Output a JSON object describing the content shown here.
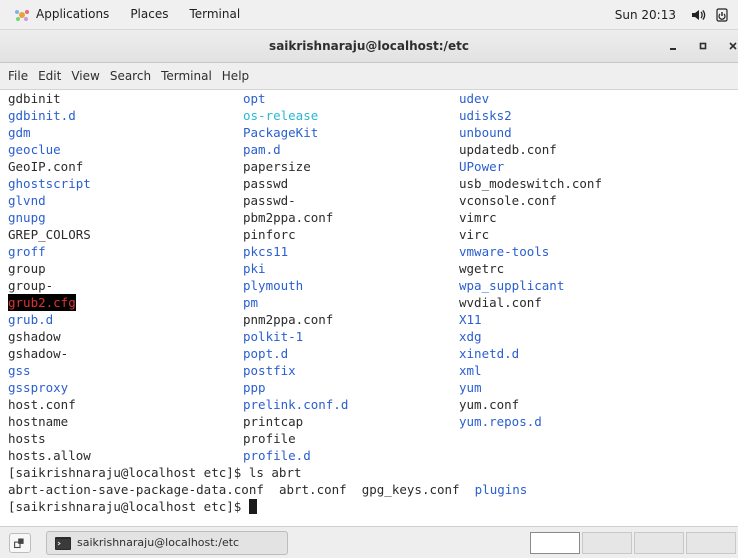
{
  "top_panel": {
    "applications": "Applications",
    "places": "Places",
    "terminal": "Terminal",
    "clock": "Sun 20:13",
    "icons": [
      "applications-icon",
      "volume-icon",
      "power-icon"
    ]
  },
  "window": {
    "title": "saikrishnaraju@localhost:/etc"
  },
  "menu": [
    "File",
    "Edit",
    "View",
    "Search",
    "Terminal",
    "Help"
  ],
  "listing": {
    "col1": [
      {
        "t": "gdbinit",
        "c": "file"
      },
      {
        "t": "gdbinit.d",
        "c": "dir"
      },
      {
        "t": "gdm",
        "c": "dir"
      },
      {
        "t": "geoclue",
        "c": "dir"
      },
      {
        "t": "GeoIP.conf",
        "c": "file"
      },
      {
        "t": "ghostscript",
        "c": "dir"
      },
      {
        "t": "glvnd",
        "c": "dir"
      },
      {
        "t": "gnupg",
        "c": "dir"
      },
      {
        "t": "GREP_COLORS",
        "c": "file"
      },
      {
        "t": "groff",
        "c": "dir"
      },
      {
        "t": "group",
        "c": "file"
      },
      {
        "t": "group-",
        "c": "file"
      },
      {
        "t": "grub2.cfg",
        "c": "hl"
      },
      {
        "t": "grub.d",
        "c": "dir"
      },
      {
        "t": "gshadow",
        "c": "file"
      },
      {
        "t": "gshadow-",
        "c": "file"
      },
      {
        "t": "gss",
        "c": "dir"
      },
      {
        "t": "gssproxy",
        "c": "dir"
      },
      {
        "t": "host.conf",
        "c": "file"
      },
      {
        "t": "hostname",
        "c": "file"
      },
      {
        "t": "hosts",
        "c": "file"
      },
      {
        "t": "hosts.allow",
        "c": "file"
      }
    ],
    "col2": [
      {
        "t": "opt",
        "c": "dir"
      },
      {
        "t": "os-release",
        "c": "link"
      },
      {
        "t": "PackageKit",
        "c": "dir"
      },
      {
        "t": "pam.d",
        "c": "dir"
      },
      {
        "t": "papersize",
        "c": "file"
      },
      {
        "t": "passwd",
        "c": "file"
      },
      {
        "t": "passwd-",
        "c": "file"
      },
      {
        "t": "pbm2ppa.conf",
        "c": "file"
      },
      {
        "t": "pinforc",
        "c": "file"
      },
      {
        "t": "pkcs11",
        "c": "dir"
      },
      {
        "t": "pki",
        "c": "dir"
      },
      {
        "t": "plymouth",
        "c": "dir"
      },
      {
        "t": "pm",
        "c": "dir"
      },
      {
        "t": "pnm2ppa.conf",
        "c": "file"
      },
      {
        "t": "polkit-1",
        "c": "dir"
      },
      {
        "t": "popt.d",
        "c": "dir"
      },
      {
        "t": "postfix",
        "c": "dir"
      },
      {
        "t": "ppp",
        "c": "dir"
      },
      {
        "t": "prelink.conf.d",
        "c": "dir"
      },
      {
        "t": "printcap",
        "c": "file"
      },
      {
        "t": "profile",
        "c": "file"
      },
      {
        "t": "profile.d",
        "c": "dir"
      }
    ],
    "col3": [
      {
        "t": "udev",
        "c": "dir"
      },
      {
        "t": "udisks2",
        "c": "dir"
      },
      {
        "t": "unbound",
        "c": "dir"
      },
      {
        "t": "updatedb.conf",
        "c": "file"
      },
      {
        "t": "UPower",
        "c": "dir"
      },
      {
        "t": "usb_modeswitch.conf",
        "c": "file"
      },
      {
        "t": "vconsole.conf",
        "c": "file"
      },
      {
        "t": "vimrc",
        "c": "file"
      },
      {
        "t": "virc",
        "c": "file"
      },
      {
        "t": "vmware-tools",
        "c": "dir"
      },
      {
        "t": "wgetrc",
        "c": "file"
      },
      {
        "t": "wpa_supplicant",
        "c": "dir"
      },
      {
        "t": "wvdial.conf",
        "c": "file"
      },
      {
        "t": "X11",
        "c": "dir"
      },
      {
        "t": "xdg",
        "c": "dir"
      },
      {
        "t": "xinetd.d",
        "c": "dir"
      },
      {
        "t": "xml",
        "c": "dir"
      },
      {
        "t": "yum",
        "c": "dir"
      },
      {
        "t": "yum.conf",
        "c": "file"
      },
      {
        "t": "yum.repos.d",
        "c": "dir"
      }
    ]
  },
  "commands": {
    "prompt1": "[saikrishnaraju@localhost etc]$ ls abrt",
    "abrt_files": [
      {
        "t": "abrt-action-save-package-data.conf",
        "c": "file"
      },
      {
        "t": "abrt.conf",
        "c": "file"
      },
      {
        "t": "gpg_keys.conf",
        "c": "file"
      },
      {
        "t": "plugins",
        "c": "dir"
      }
    ],
    "prompt2": "[saikrishnaraju@localhost etc]$ "
  },
  "taskbar": {
    "task_label": "saikrishnaraju@localhost:/etc",
    "workspaces": 4,
    "active_workspace": 1
  },
  "colors": {
    "dir": "#2a5fd0",
    "link": "#27b9d3",
    "highlight_bg": "#000000",
    "highlight_fg": "#e03131"
  }
}
